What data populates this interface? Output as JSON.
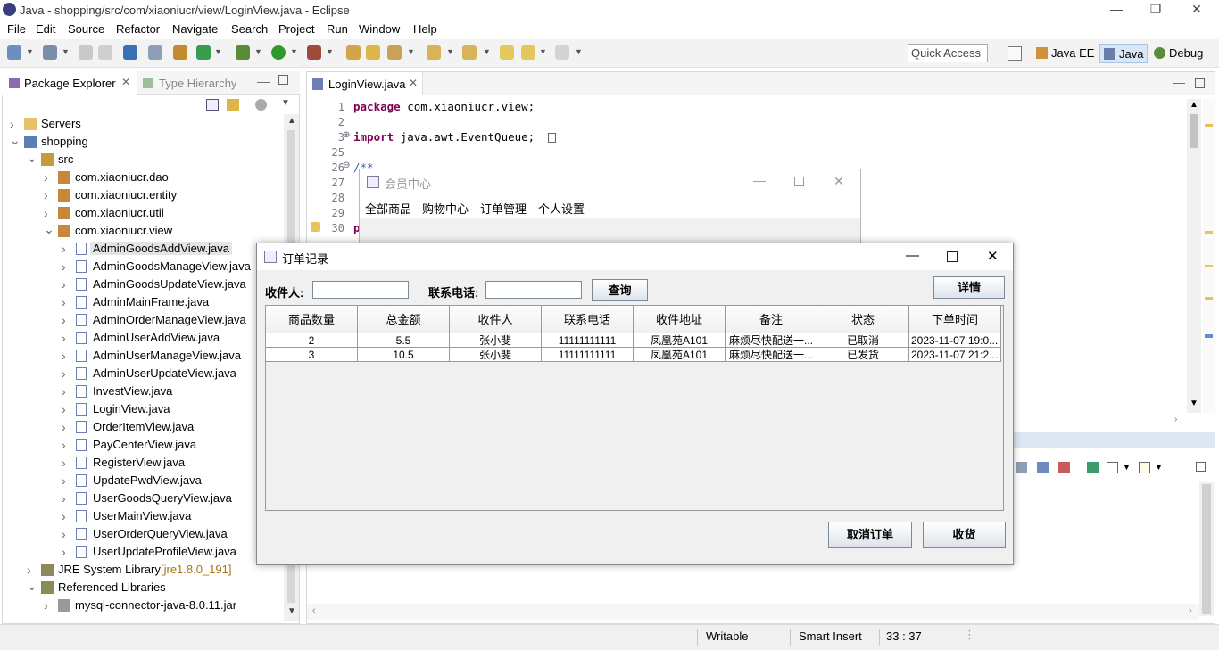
{
  "window": {
    "title": "Java - shopping/src/com/xiaoniucr/view/LoginView.java - Eclipse"
  },
  "menu": [
    "File",
    "Edit",
    "Source",
    "Refactor",
    "Navigate",
    "Search",
    "Project",
    "Run",
    "Window",
    "Help"
  ],
  "toolbar": {
    "quick_access": "Quick Access",
    "perspectives": [
      "Java EE",
      "Java",
      "Debug"
    ]
  },
  "package_explorer": {
    "tabs": [
      "Package Explorer",
      "Type Hierarchy"
    ],
    "tree": [
      {
        "label": "Servers",
        "level": 0,
        "expanded": false,
        "kind": "folder"
      },
      {
        "label": "shopping",
        "level": 0,
        "expanded": true,
        "kind": "project"
      },
      {
        "label": "src",
        "level": 1,
        "expanded": true,
        "kind": "srcfolder"
      },
      {
        "label": "com.xiaoniucr.dao",
        "level": 2,
        "expanded": false,
        "kind": "package"
      },
      {
        "label": "com.xiaoniucr.entity",
        "level": 2,
        "expanded": false,
        "kind": "package"
      },
      {
        "label": "com.xiaoniucr.util",
        "level": 2,
        "expanded": false,
        "kind": "package"
      },
      {
        "label": "com.xiaoniucr.view",
        "level": 2,
        "expanded": true,
        "kind": "package"
      },
      {
        "label": "AdminGoodsAddView.java",
        "level": 3,
        "expanded": false,
        "kind": "java",
        "selected": true
      },
      {
        "label": "AdminGoodsManageView.java",
        "level": 3,
        "expanded": false,
        "kind": "java"
      },
      {
        "label": "AdminGoodsUpdateView.java",
        "level": 3,
        "expanded": false,
        "kind": "java"
      },
      {
        "label": "AdminMainFrame.java",
        "level": 3,
        "expanded": false,
        "kind": "java"
      },
      {
        "label": "AdminOrderManageView.java",
        "level": 3,
        "expanded": false,
        "kind": "java"
      },
      {
        "label": "AdminUserAddView.java",
        "level": 3,
        "expanded": false,
        "kind": "java"
      },
      {
        "label": "AdminUserManageView.java",
        "level": 3,
        "expanded": false,
        "kind": "java"
      },
      {
        "label": "AdminUserUpdateView.java",
        "level": 3,
        "expanded": false,
        "kind": "java"
      },
      {
        "label": "InvestView.java",
        "level": 3,
        "expanded": false,
        "kind": "java"
      },
      {
        "label": "LoginView.java",
        "level": 3,
        "expanded": false,
        "kind": "java"
      },
      {
        "label": "OrderItemView.java",
        "level": 3,
        "expanded": false,
        "kind": "java"
      },
      {
        "label": "PayCenterView.java",
        "level": 3,
        "expanded": false,
        "kind": "java"
      },
      {
        "label": "RegisterView.java",
        "level": 3,
        "expanded": false,
        "kind": "java"
      },
      {
        "label": "UpdatePwdView.java",
        "level": 3,
        "expanded": false,
        "kind": "java"
      },
      {
        "label": "UserGoodsQueryView.java",
        "level": 3,
        "expanded": false,
        "kind": "java"
      },
      {
        "label": "UserMainView.java",
        "level": 3,
        "expanded": false,
        "kind": "java"
      },
      {
        "label": "UserOrderQueryView.java",
        "level": 3,
        "expanded": false,
        "kind": "java"
      },
      {
        "label": "UserUpdateProfileView.java",
        "level": 3,
        "expanded": false,
        "kind": "java"
      },
      {
        "label": "JRE System Library",
        "suffix": "[jre1.8.0_191]",
        "level": 1,
        "expanded": false,
        "kind": "lib"
      },
      {
        "label": "Referenced Libraries",
        "level": 1,
        "expanded": true,
        "kind": "lib"
      },
      {
        "label": "mysql-connector-java-8.0.11.jar",
        "level": 2,
        "expanded": false,
        "kind": "jar"
      }
    ]
  },
  "editor": {
    "tab": "LoginView.java",
    "lines": [
      {
        "n": "1",
        "code": [
          {
            "t": "package",
            "kw": true
          },
          {
            "t": " com.xiaoniucr.view;"
          }
        ]
      },
      {
        "n": "2",
        "code": []
      },
      {
        "n": "3",
        "code": [
          {
            "t": "import",
            "kw": true
          },
          {
            "t": " java.awt.EventQueue;"
          }
        ]
      },
      {
        "n": "25",
        "code": []
      },
      {
        "n": "26",
        "code": [
          {
            "t": "/**"
          }
        ]
      },
      {
        "n": "27",
        "code": []
      },
      {
        "n": "28",
        "code": []
      },
      {
        "n": "29",
        "code": []
      },
      {
        "n": "30",
        "code": [
          {
            "t": "p",
            "kw": true
          }
        ]
      }
    ]
  },
  "status": {
    "writable": "Writable",
    "insert_mode": "Smart Insert",
    "position": "33 : 37"
  },
  "member_center": {
    "title": "会员中心",
    "menu": [
      "全部商品",
      "购物中心",
      "订单管理",
      "个人设置"
    ]
  },
  "order_dialog": {
    "title": "订单记录",
    "receiver_label": "收件人:",
    "receiver_value": "",
    "phone_label": "联系电话:",
    "phone_value": "",
    "query_button": "查询",
    "detail_button": "详情",
    "columns": [
      "商品数量",
      "总金额",
      "收件人",
      "联系电话",
      "收件地址",
      "备注",
      "状态",
      "下单时间"
    ],
    "rows": [
      [
        "2",
        "5.5",
        "张小斐",
        "11111111111",
        "凤凰苑A101",
        "麻烦尽快配送一...",
        "已取消",
        "2023-11-07 19:0..."
      ],
      [
        "3",
        "10.5",
        "张小斐",
        "11111111111",
        "凤凰苑A101",
        "麻烦尽快配送一...",
        "已发货",
        "2023-11-07 21:2..."
      ]
    ],
    "cancel_button": "取消订单",
    "receive_button": "收货"
  }
}
